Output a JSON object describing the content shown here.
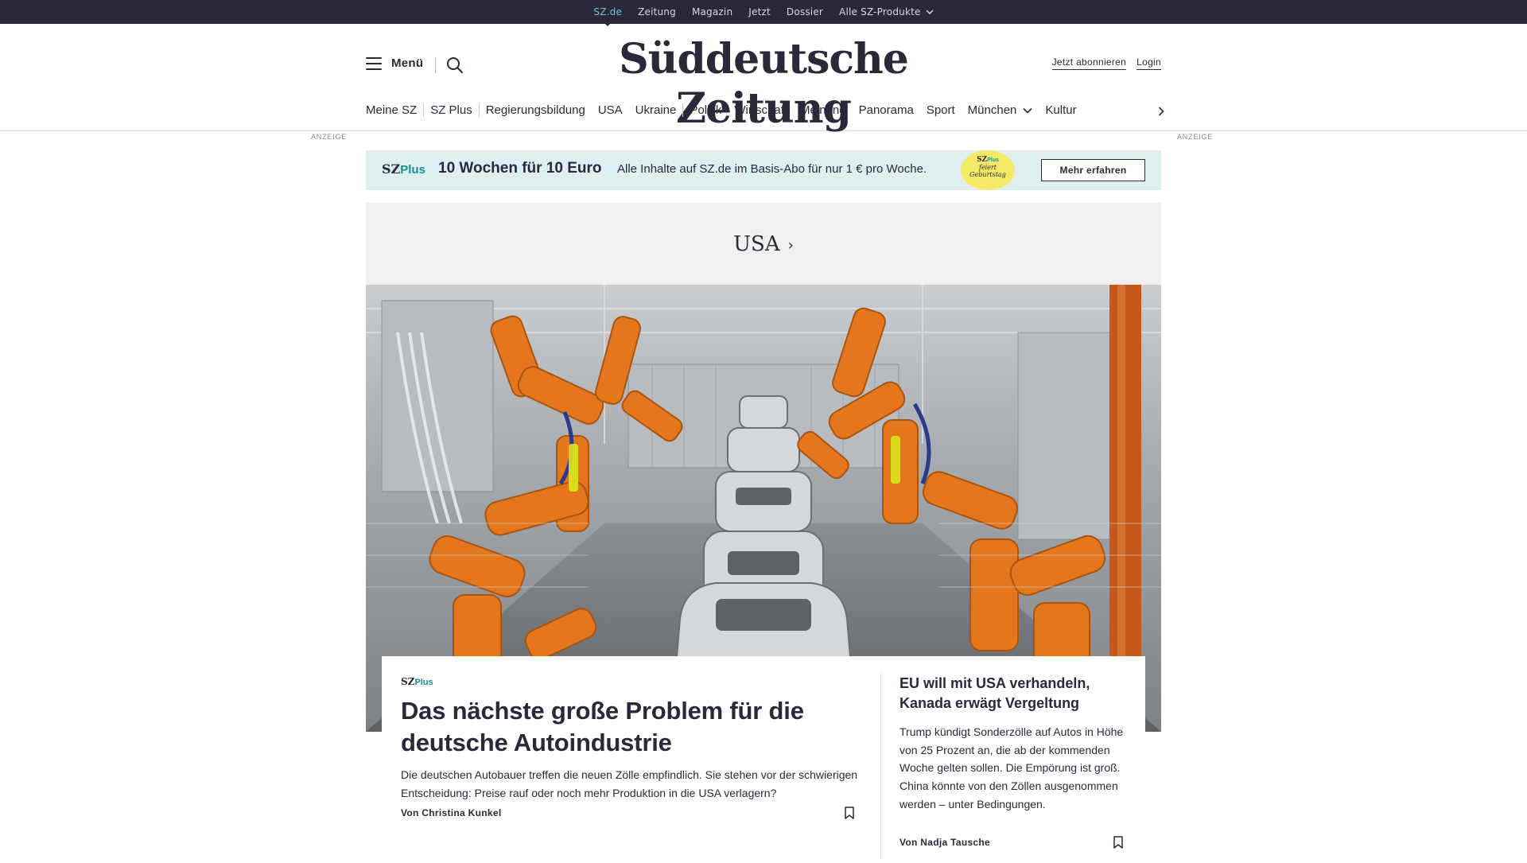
{
  "topbar": {
    "items": [
      {
        "label": "SZ.de"
      },
      {
        "label": "Zeitung"
      },
      {
        "label": "Magazin"
      },
      {
        "label": "Jetzt"
      },
      {
        "label": "Dossier"
      },
      {
        "label": "Alle SZ-Produkte"
      }
    ]
  },
  "header": {
    "menu_label": "Menü",
    "logo": "Süddeutsche Zeitung",
    "subscribe_label": "Jetzt abonnieren",
    "login_label": "Login"
  },
  "nav": {
    "items": [
      {
        "label": "Meine SZ"
      },
      {
        "label": "SZ Plus"
      },
      {
        "label": "Regierungsbildung"
      },
      {
        "label": "USA"
      },
      {
        "label": "Ukraine"
      },
      {
        "label": "Politik"
      },
      {
        "label": "Wirtschaft"
      },
      {
        "label": "Meinung"
      },
      {
        "label": "Panorama"
      },
      {
        "label": "Sport"
      },
      {
        "label": "München"
      },
      {
        "label": "Kultur"
      }
    ]
  },
  "ads": {
    "label": "ANZEIGE"
  },
  "promo": {
    "brand_sz": "SZ",
    "brand_plus": "Plus",
    "offer": "10 Wochen für 10 Euro",
    "description": "Alle Inhalte auf SZ.de im Basis-Abo für nur 1 € pro Woche.",
    "badge_sz": "SZ",
    "badge_plus": "Plus",
    "badge_line1": "feiert",
    "badge_line2": "Geburtstag",
    "cta_label": "Mehr erfahren"
  },
  "section": {
    "title": "USA",
    "arrow": "›"
  },
  "main_article": {
    "kicker_sz": "SZ",
    "kicker_plus": "Plus",
    "headline": "Das nächste große Problem für die deutsche Autoindustrie",
    "teaser": "Die deutschen Autobauer treffen die neuen Zölle empfindlich. Sie stehen vor der schwierigen Entscheidung: Preise rauf oder noch mehr Produktion in die USA verlagern?",
    "byline": "Von Christina Kunkel"
  },
  "side_article": {
    "headline": "EU will mit USA verhandeln, Kanada erwägt Vergeltung",
    "teaser": "Trump kündigt Sonderzölle auf Autos in Höhe von 25 Prozent an, die ab der kommenden Woche gelten sollen. Die Empörung ist groß. China könnte von den Zöllen ausgenommen werden – unter Bedingungen.",
    "byline": "Von Nadja Tausche"
  },
  "colors": {
    "topbar_bg": "#29293a",
    "active_link": "#71c1d0",
    "promo_bg": "#dfeeee",
    "badge_yellow": "#f5ea65",
    "plus_teal": "#1a8f8f",
    "robot_orange": "#e4761d"
  }
}
